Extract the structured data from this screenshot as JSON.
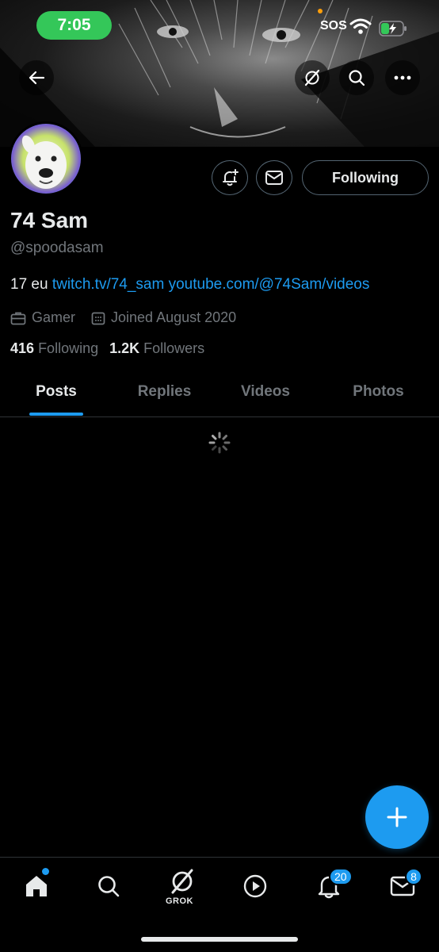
{
  "status_bar": {
    "time": "7:05",
    "sos": "SOS",
    "icons": [
      "wifi-icon",
      "battery-charging-icon"
    ]
  },
  "banner": {
    "icons": [
      "back-arrow-icon",
      "grok-icon",
      "search-icon",
      "more-icon"
    ]
  },
  "profile": {
    "display_name": "74 Sam",
    "handle": "@spoodasam",
    "bio_prefix": "17 eu",
    "bio_links": [
      "twitch.tv/74_sam",
      "youtube.com/@74Sam/videos"
    ],
    "category": "Gamer",
    "joined": "Joined August 2020",
    "following_count": "416",
    "following_label": "Following",
    "followers_count": "1.2K",
    "followers_label": "Followers"
  },
  "actions": {
    "following_button": "Following",
    "icons": [
      "bell-plus-icon",
      "mail-icon"
    ]
  },
  "tabs": [
    {
      "label": "Posts",
      "active": true
    },
    {
      "label": "Replies",
      "active": false
    },
    {
      "label": "Videos",
      "active": false
    },
    {
      "label": "Photos",
      "active": false
    }
  ],
  "bottom_nav": {
    "grok_label": "GROK",
    "notifications_badge": "20",
    "messages_badge": "8",
    "icons": [
      "home-icon",
      "search-icon",
      "grok-icon",
      "play-icon",
      "bell-icon",
      "mail-icon"
    ]
  },
  "colors": {
    "accent": "#1d9bf0",
    "background": "#000000",
    "text_primary": "#e7e9ea",
    "text_secondary": "#71767b",
    "status_pill": "#34c759"
  }
}
